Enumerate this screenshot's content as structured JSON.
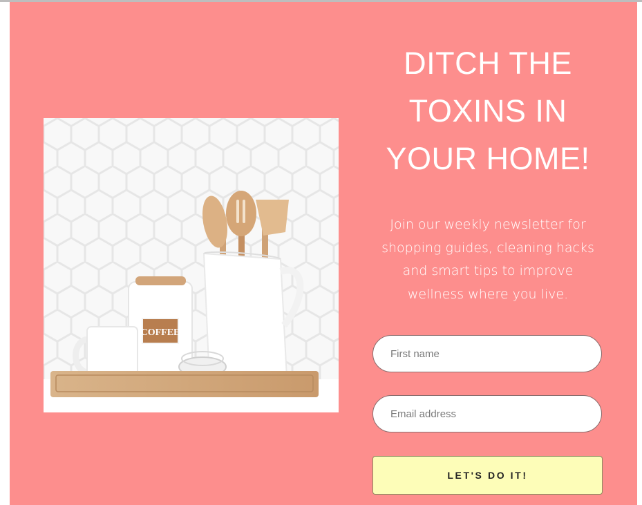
{
  "hero": {
    "title_lines": [
      "DITCH THE",
      "TOXINS IN",
      "YOUR HOME!"
    ],
    "description_lines": [
      "Join our weekly newsletter for",
      "shopping guides, cleaning hacks",
      "and smart tips to improve",
      "wellness where you live."
    ]
  },
  "photo": {
    "canister_label": "COFFEE"
  },
  "form": {
    "first_name_placeholder": "First name",
    "email_placeholder": "Email address",
    "submit_label": "LET'S DO IT!"
  },
  "colors": {
    "panel_background": "#fd8e8d",
    "button_background": "#fdfdb8",
    "text_on_panel": "#ffffff"
  }
}
